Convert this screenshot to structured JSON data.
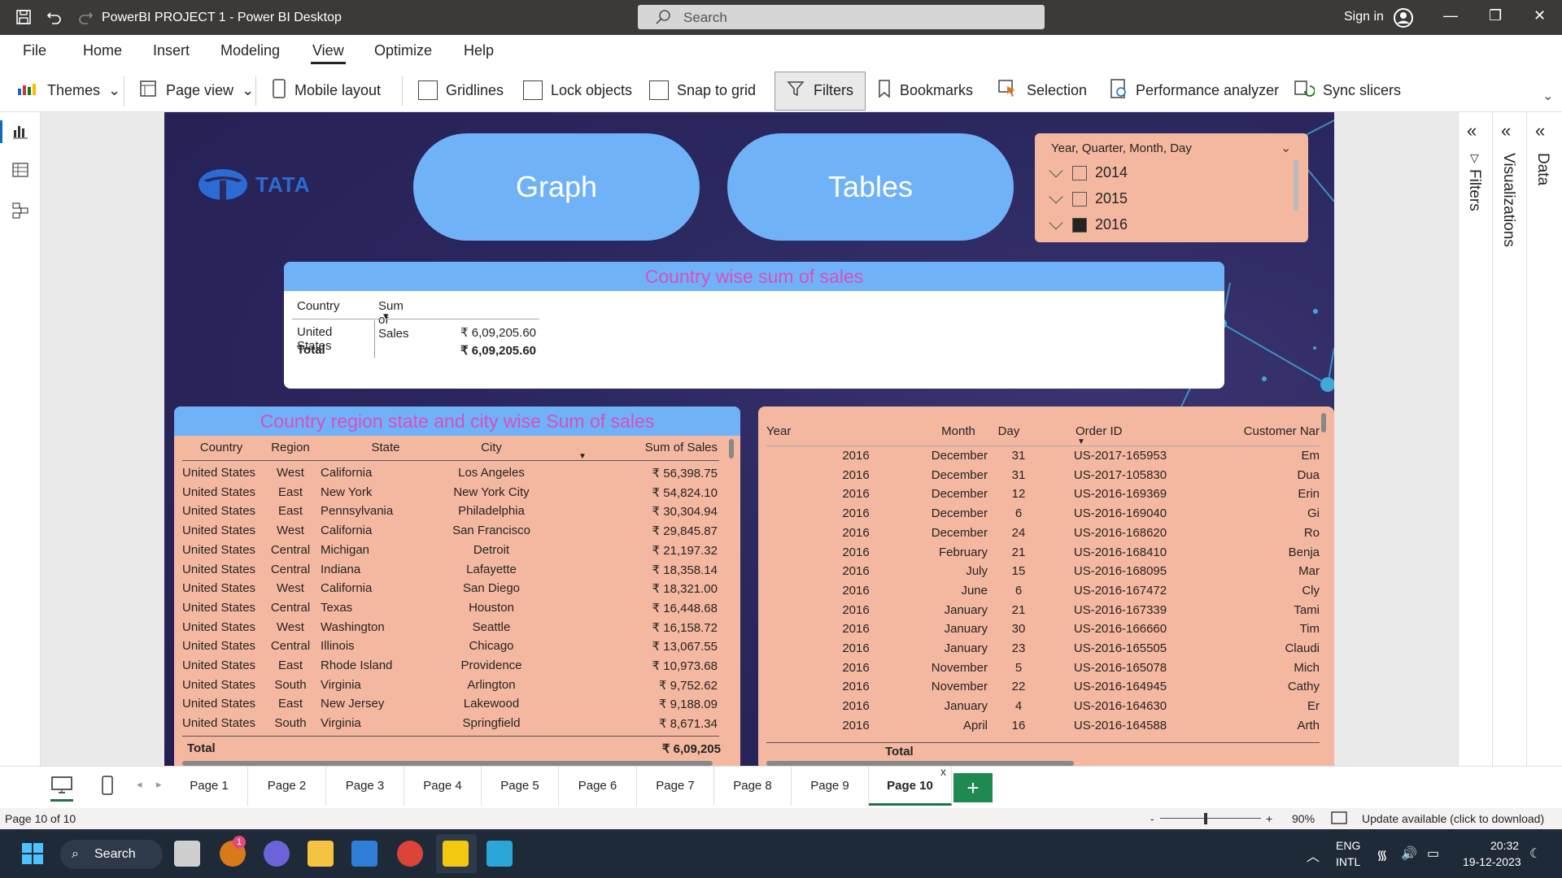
{
  "titlebar": {
    "app_title": "PowerBI PROJECT 1 - Power BI Desktop",
    "search_placeholder": "Search",
    "sign_in": "Sign in"
  },
  "menu": [
    "File",
    "Home",
    "Insert",
    "Modeling",
    "View",
    "Optimize",
    "Help"
  ],
  "active_menu": "View",
  "ribbon": {
    "themes": "Themes",
    "page_view": "Page view",
    "mobile_layout": "Mobile layout",
    "gridlines": "Gridlines",
    "lock_objects": "Lock objects",
    "snap_to_grid": "Snap to grid",
    "filters": "Filters",
    "bookmarks": "Bookmarks",
    "selection": "Selection",
    "performance_analyzer": "Performance analyzer",
    "sync_slicers": "Sync slicers"
  },
  "panes": {
    "filters": "Filters",
    "visualizations": "Visualizations",
    "data": "Data"
  },
  "report": {
    "logo_text": "TATA",
    "graph_button": "Graph",
    "tables_button": "Tables",
    "slicer": {
      "title": "Year, Quarter, Month, Day",
      "items": [
        {
          "label": "2014",
          "checked": false
        },
        {
          "label": "2015",
          "checked": false
        },
        {
          "label": "2016",
          "checked": true
        }
      ]
    },
    "country_card": {
      "title": "Country wise sum of sales",
      "columns": [
        "Country",
        "Sum of Sales"
      ],
      "rows": [
        [
          "United States",
          "₹ 6,09,205.60"
        ]
      ],
      "total": [
        "Total",
        "₹ 6,09,205.60"
      ]
    },
    "region_table": {
      "title": "Country region state and city wise Sum of sales",
      "columns": [
        "Country",
        "Region",
        "State",
        "City",
        "Sum of Sales"
      ],
      "rows": [
        [
          "United States",
          "West",
          "California",
          "Los Angeles",
          "₹ 56,398.75"
        ],
        [
          "United States",
          "East",
          "New York",
          "New York City",
          "₹ 54,824.10"
        ],
        [
          "United States",
          "East",
          "Pennsylvania",
          "Philadelphia",
          "₹ 30,304.94"
        ],
        [
          "United States",
          "West",
          "California",
          "San Francisco",
          "₹ 29,845.87"
        ],
        [
          "United States",
          "Central",
          "Michigan",
          "Detroit",
          "₹ 21,197.32"
        ],
        [
          "United States",
          "Central",
          "Indiana",
          "Lafayette",
          "₹ 18,358.14"
        ],
        [
          "United States",
          "West",
          "California",
          "San Diego",
          "₹ 18,321.00"
        ],
        [
          "United States",
          "Central",
          "Texas",
          "Houston",
          "₹ 16,448.68"
        ],
        [
          "United States",
          "West",
          "Washington",
          "Seattle",
          "₹ 16,158.72"
        ],
        [
          "United States",
          "Central",
          "Illinois",
          "Chicago",
          "₹ 13,067.55"
        ],
        [
          "United States",
          "East",
          "Rhode Island",
          "Providence",
          "₹ 10,973.68"
        ],
        [
          "United States",
          "South",
          "Virginia",
          "Arlington",
          "₹ 9,752.62"
        ],
        [
          "United States",
          "East",
          "New Jersey",
          "Lakewood",
          "₹ 9,188.09"
        ],
        [
          "United States",
          "South",
          "Virginia",
          "Springfield",
          "₹ 8,671.34"
        ]
      ],
      "total_label": "Total",
      "total_value": "₹ 6,09,205"
    },
    "order_table": {
      "columns": [
        "Year",
        "Month",
        "Day",
        "Order ID",
        "Customer Nar"
      ],
      "rows": [
        [
          "2016",
          "December",
          "31",
          "US-2017-165953",
          "Em"
        ],
        [
          "2016",
          "December",
          "31",
          "US-2017-105830",
          "Dua"
        ],
        [
          "2016",
          "December",
          "12",
          "US-2016-169369",
          "Erin"
        ],
        [
          "2016",
          "December",
          "6",
          "US-2016-169040",
          "Gi"
        ],
        [
          "2016",
          "December",
          "24",
          "US-2016-168620",
          "Ro"
        ],
        [
          "2016",
          "February",
          "21",
          "US-2016-168410",
          "Benja"
        ],
        [
          "2016",
          "July",
          "15",
          "US-2016-168095",
          "Mar"
        ],
        [
          "2016",
          "June",
          "6",
          "US-2016-167472",
          "Cly"
        ],
        [
          "2016",
          "January",
          "21",
          "US-2016-167339",
          "Tami"
        ],
        [
          "2016",
          "January",
          "30",
          "US-2016-166660",
          "Tim"
        ],
        [
          "2016",
          "January",
          "23",
          "US-2016-165505",
          "Claudi"
        ],
        [
          "2016",
          "November",
          "5",
          "US-2016-165078",
          "Mich"
        ],
        [
          "2016",
          "November",
          "22",
          "US-2016-164945",
          "Cathy"
        ],
        [
          "2016",
          "January",
          "4",
          "US-2016-164630",
          "Er"
        ],
        [
          "2016",
          "April",
          "16",
          "US-2016-164588",
          "Arth"
        ]
      ],
      "total_label": "Total"
    }
  },
  "pages": [
    "Page 1",
    "Page 2",
    "Page 3",
    "Page 4",
    "Page 5",
    "Page 6",
    "Page 7",
    "Page 8",
    "Page 9",
    "Page 10"
  ],
  "active_page": "Page 10",
  "add_page": "+",
  "page_close": "x",
  "status": {
    "page_indicator": "Page 10 of 10",
    "zoom_minus": "-",
    "zoom_plus": "+",
    "zoom": "90%",
    "update": "Update available (click to download)"
  },
  "taskbar": {
    "search": "Search",
    "badge": "1",
    "lang1": "ENG",
    "lang2": "INTL",
    "time": "20:32",
    "date": "19-12-2023"
  },
  "colors": {
    "accent_blue": "#6fb2f8",
    "title_pink": "#d94fbf",
    "panel_salmon": "#f4b8a0",
    "report_bg": "#2c2860",
    "add_page_green": "#1e8a4f"
  }
}
